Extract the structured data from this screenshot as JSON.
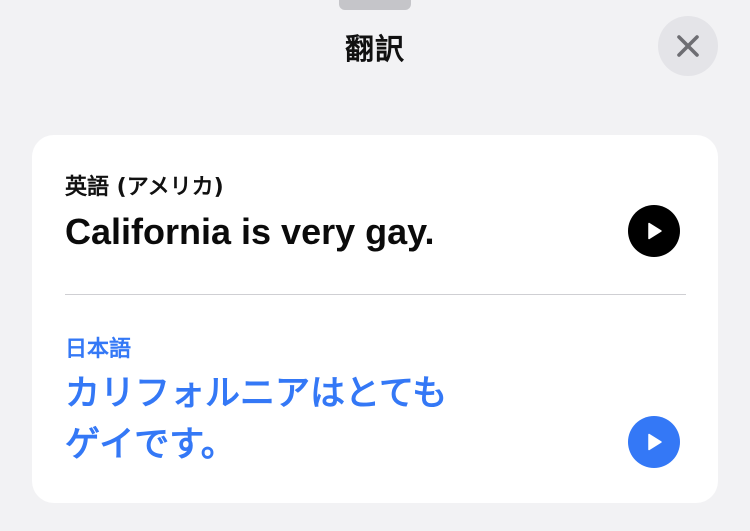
{
  "sheet": {
    "title": "翻訳"
  },
  "source": {
    "language": "英語 (アメリカ)",
    "text": "California is very gay."
  },
  "target": {
    "language": "日本語",
    "line1": "カリフォルニアはとても",
    "line2": "ゲイです。"
  },
  "colors": {
    "background": "#f2f2f4",
    "accent": "#3478f6",
    "card": "#ffffff"
  },
  "icons": {
    "close": "close-icon",
    "play": "play-icon"
  }
}
